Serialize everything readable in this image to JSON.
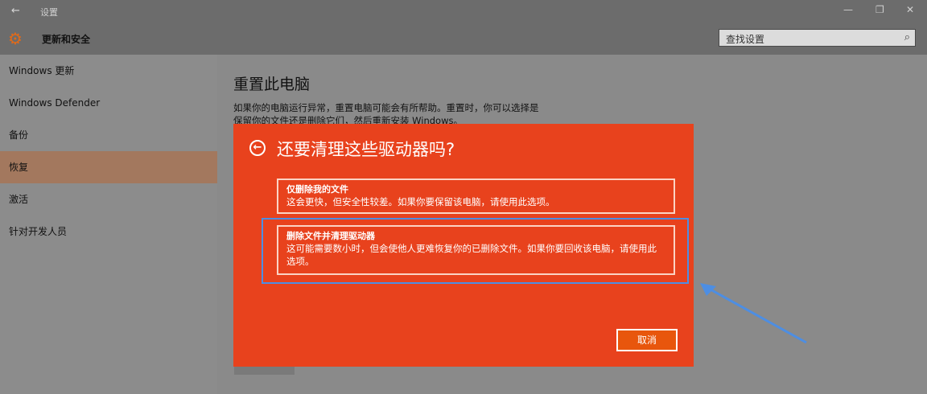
{
  "window": {
    "back_icon": "back-arrow-icon",
    "title": "设置"
  },
  "header": {
    "section_title": "更新和安全",
    "search_placeholder": "查找设置"
  },
  "sidebar": {
    "items": [
      {
        "label": "Windows 更新"
      },
      {
        "label": "Windows Defender"
      },
      {
        "label": "备份"
      },
      {
        "label": "恢复",
        "active": true
      },
      {
        "label": "激活"
      },
      {
        "label": "针对开发人员"
      }
    ]
  },
  "main": {
    "heading": "重置此电脑",
    "description": "如果你的电脑运行异常，重置电脑可能会有所帮助。重置时，你可以选择是保留你的文件还是删除它们，然后重新安装 Windows。"
  },
  "dialog": {
    "title": "还要清理这些驱动器吗?",
    "options": [
      {
        "title": "仅删除我的文件",
        "description": "这会更快，但安全性较差。如果你要保留该电脑，请使用此选项。"
      },
      {
        "title": "删除文件并清理驱动器",
        "description": "这可能需要数小时，但会使他人更难恢复你的已删除文件。如果你要回收该电脑，请使用此选项。"
      }
    ],
    "cancel_label": "取消"
  },
  "colors": {
    "dialog_bg": "#e8421d",
    "focus_ring": "#4d8ee3",
    "accent": "#e06a1a"
  }
}
